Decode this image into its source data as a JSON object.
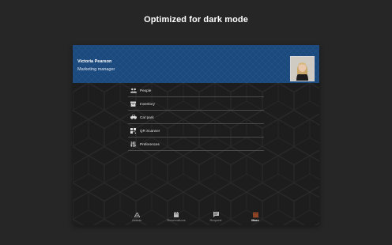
{
  "headline": "Optimized for dark mode",
  "profile": {
    "name": "Victoria Pearson",
    "role": "Marketing manager"
  },
  "menu": {
    "items": [
      {
        "label": "People",
        "icon": "people-icon"
      },
      {
        "label": "Inventory",
        "icon": "inventory-box-icon"
      },
      {
        "label": "Car park",
        "icon": "car-icon"
      },
      {
        "label": "QR Scanner",
        "icon": "qr-code-icon"
      },
      {
        "label": "Preferences",
        "icon": "sliders-icon"
      }
    ]
  },
  "bottom_nav": {
    "items": [
      {
        "label": "Assets",
        "icon": "assets-icon"
      },
      {
        "label": "Reservations",
        "icon": "calendar-icon"
      },
      {
        "label": "Request",
        "icon": "chat-icon"
      },
      {
        "label": "More",
        "icon": "menu-icon",
        "active": true
      }
    ]
  },
  "colors": {
    "background": "#262626",
    "header_blue": "#1d4a7c",
    "active_accent": "#e8632b"
  }
}
